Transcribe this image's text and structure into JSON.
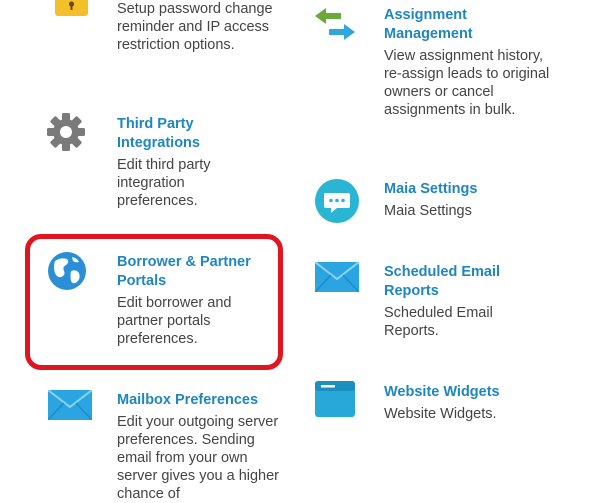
{
  "items": [
    {
      "id": "security",
      "title": "",
      "desc": "Setup password change reminder and IP access restriction options."
    },
    {
      "id": "assignment",
      "title": "Assignment Management",
      "desc": "View assignment history, re-assign leads to original owners or cancel assignments in bulk."
    },
    {
      "id": "third_party",
      "title": "Third Party Integrations",
      "desc": "Edit third party integration preferences."
    },
    {
      "id": "maia",
      "title": "Maia Settings",
      "desc": "Maia Settings"
    },
    {
      "id": "borrower",
      "title": "Borrower & Partner Portals",
      "desc": "Edit borrower and partner portals preferences."
    },
    {
      "id": "scheduled",
      "title": "Scheduled Email Reports",
      "desc": "Scheduled Email Reports."
    },
    {
      "id": "mailbox",
      "title": "Mailbox Preferences",
      "desc": "Edit your outgoing server preferences. Sending email from your own server gives you a higher chance of"
    },
    {
      "id": "widgets",
      "title": "Website Widgets",
      "desc": "Website Widgets."
    }
  ],
  "colors": {
    "link": "#1f86c1",
    "highlight": "#e0151f",
    "accent": "#2bb5d4"
  },
  "icons": [
    "lock-icon",
    "arrows-icon",
    "gear-icon",
    "chat-icon",
    "globe-icon",
    "envelope-icon",
    "envelope-icon",
    "widget-icon"
  ]
}
